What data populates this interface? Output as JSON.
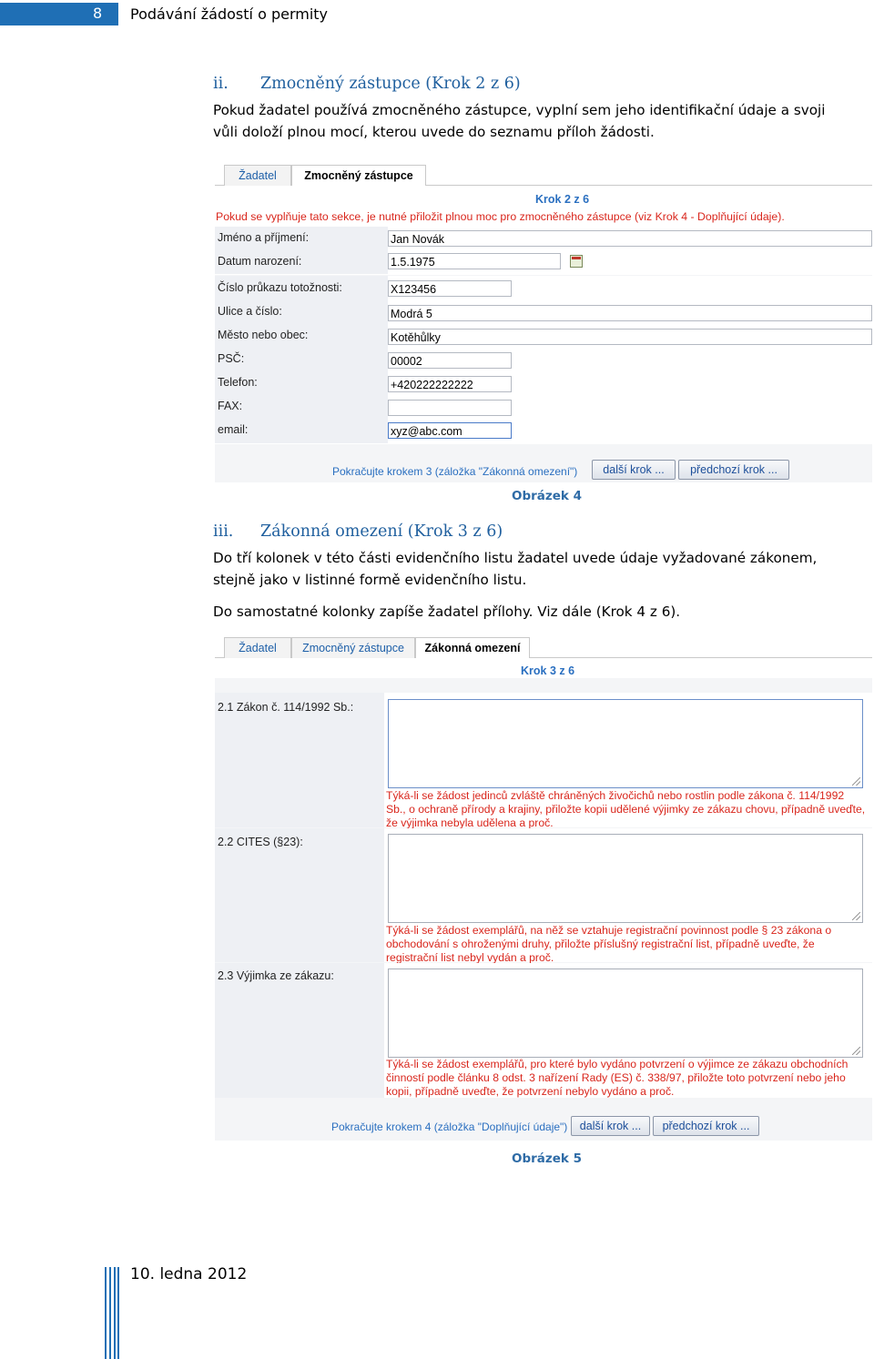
{
  "header": {
    "page_number": "8",
    "title": "Podávání žádostí o permity"
  },
  "section2": {
    "number": "ii.",
    "title": "Zmocněný zástupce (Krok 2 z 6)",
    "para_lines": [
      "Pokud žadatel používá zmocněného zástupce, vyplní sem jeho identifikační údaje a svoji",
      "vůli doloží plnou mocí, kterou uvede do seznamu příloh žádosti."
    ],
    "caption": "Obrázek 4"
  },
  "shot1": {
    "tabs": [
      "Žadatel",
      "Zmocněný zástupce"
    ],
    "active_tab": "Zmocněný zástupce",
    "step": "Krok 2 z 6",
    "warning": "Pokud se vyplňuje tato sekce, je nutné přiložit plnou moc pro zmocněného zástupce (viz Krok 4 - Doplňující údaje).",
    "fields": [
      {
        "label": "Jméno a příjmení:",
        "value": "Jan Novák"
      },
      {
        "label": "Datum narození:",
        "value": "1.5.1975"
      },
      {
        "label": "Číslo průkazu totožnosti:",
        "value": "X123456"
      },
      {
        "label": "Ulice a číslo:",
        "value": "Modrá 5"
      },
      {
        "label": "Město nebo obec:",
        "value": "Kotěhůlky"
      },
      {
        "label": "PSČ:",
        "value": "00002"
      },
      {
        "label": "Telefon:",
        "value": "+420222222222"
      },
      {
        "label": "FAX:",
        "value": ""
      },
      {
        "label": "email:",
        "value": "xyz@abc.com"
      }
    ],
    "footer_text": "Pokračujte krokem 3 (záložka \"Zákonná omezení\")",
    "next_button": "další krok ...",
    "prev_button": "předchozí krok ..."
  },
  "section3": {
    "number": "iii.",
    "title": "Zákonná omezení (Krok 3 z 6)",
    "para_lines": [
      "Do tří kolonek v této části evidenčního listu žadatel uvede údaje vyžadované zákonem,",
      "stejně jako v listinné formě evidenčního listu."
    ],
    "para2": "Do samostatné kolonky zapíše žadatel přílohy. Viz dále (Krok 4 z 6).",
    "caption": "Obrázek 5"
  },
  "shot2": {
    "tabs": [
      "Žadatel",
      "Zmocněný zástupce",
      "Zákonná omezení"
    ],
    "active_tab": "Zákonná omezení",
    "step": "Krok 3 z 6",
    "sections": [
      {
        "label": "2.1 Zákon č. 114/1992 Sb.:",
        "note_lines": [
          "Týká-li se žádost jedinců zvláště chráněných živočichů nebo rostlin podle zákona č. 114/1992",
          "Sb., o ochraně přírody a krajiny, přiložte kopii udělené výjimky ze zákazu chovu, případně uveďte,",
          "že výjimka nebyla udělena a proč."
        ]
      },
      {
        "label": "2.2 CITES (§23):",
        "note_lines": [
          "Týká-li se žádost exemplářů, na něž se vztahuje registrační povinnost podle § 23 zákona o",
          "obchodování s ohroženými druhy, přiložte příslušný registrační list, případně uveďte, že",
          "registrační list nebyl vydán a proč."
        ]
      },
      {
        "label": "2.3 Výjimka ze zákazu:",
        "note_lines": [
          "Týká-li se žádost exemplářů, pro které bylo vydáno potvrzení o výjimce ze zákazu obchodních",
          "činností podle článku 8 odst. 3 nařízení Rady (ES) č. 338/97, přiložte toto potvrzení nebo jeho",
          "kopii, případně uveďte, že potvrzení nebylo vydáno a proč."
        ]
      }
    ],
    "footer_text": "Pokračujte krokem 4 (záložka \"Doplňující údaje\")",
    "next_button": "další krok ...",
    "prev_button": "předchozí krok ..."
  },
  "footer": {
    "date": "10. ledna 2012"
  }
}
